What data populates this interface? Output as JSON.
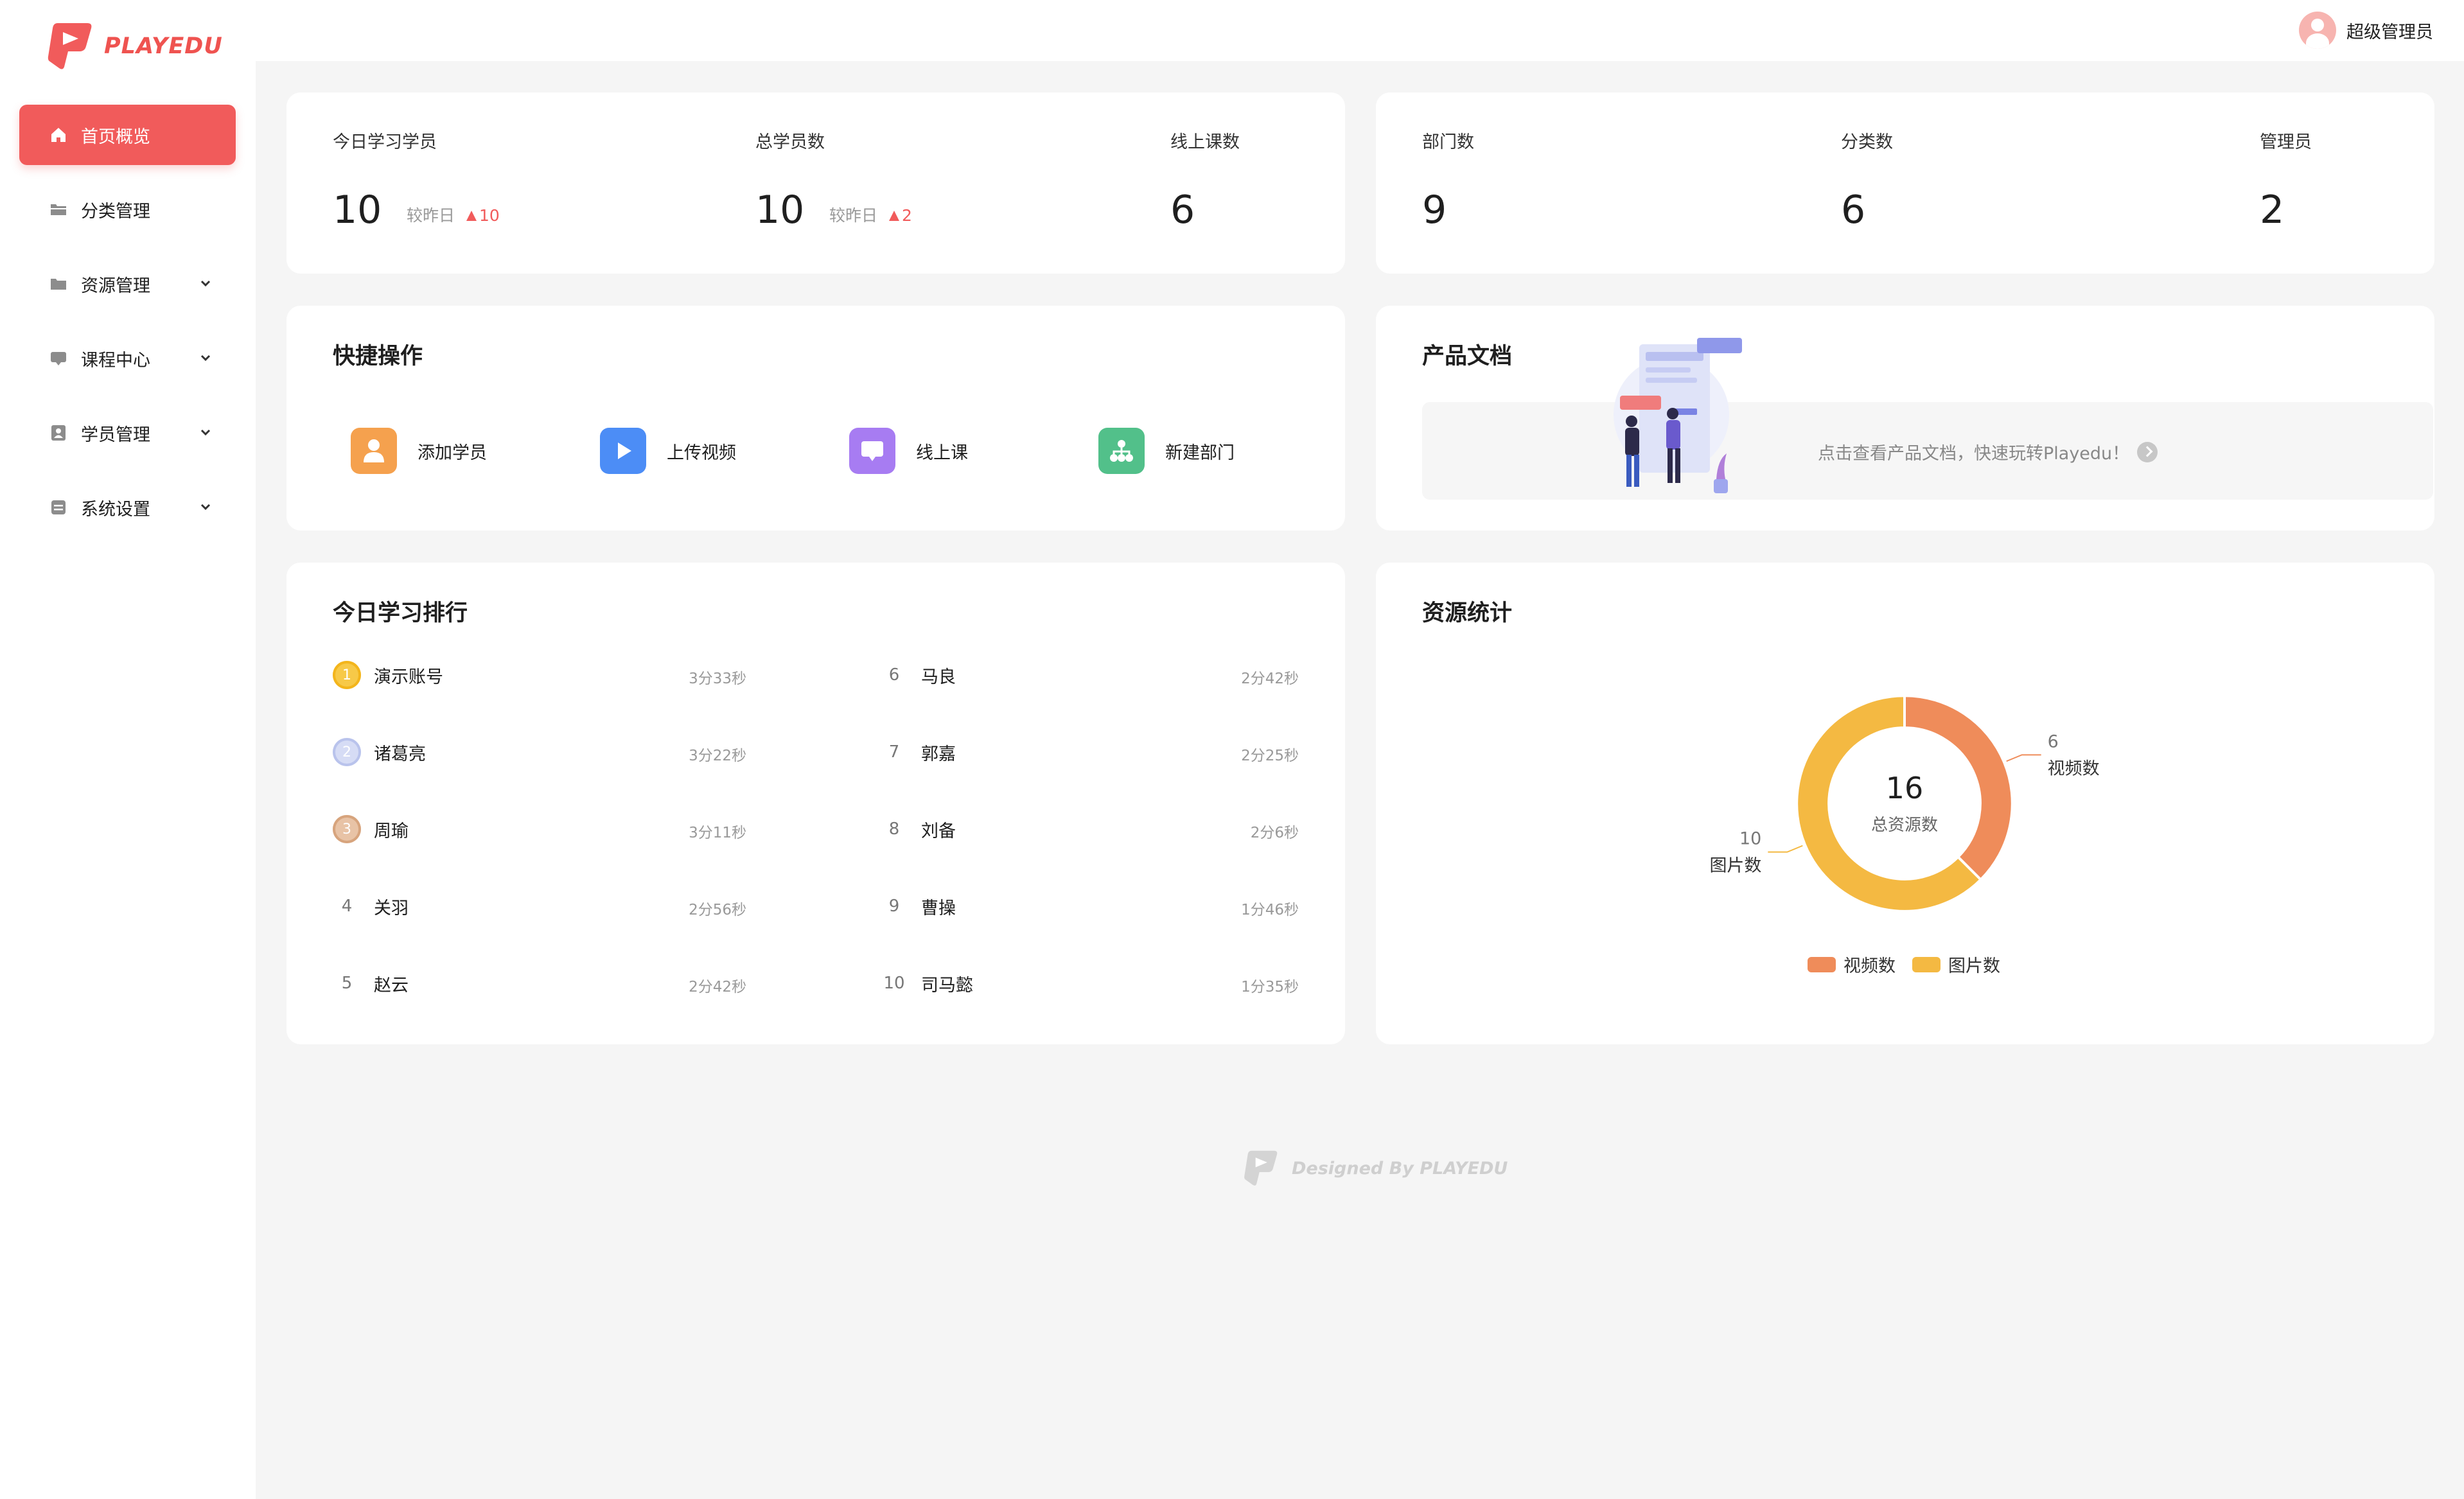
{
  "app": {
    "logo_text": "PLAYEDU",
    "brand_color": "#f15b5b"
  },
  "sidebar": {
    "items": [
      {
        "label": "首页概览",
        "icon": "home-icon",
        "active": true,
        "expandable": false
      },
      {
        "label": "分类管理",
        "icon": "folder-category-icon",
        "active": false,
        "expandable": false
      },
      {
        "label": "资源管理",
        "icon": "folder-icon",
        "active": false,
        "expandable": true
      },
      {
        "label": "课程中心",
        "icon": "monitor-icon",
        "active": false,
        "expandable": true
      },
      {
        "label": "学员管理",
        "icon": "user-card-icon",
        "active": false,
        "expandable": true
      },
      {
        "label": "系统设置",
        "icon": "settings-box-icon",
        "active": false,
        "expandable": true
      }
    ]
  },
  "header": {
    "user_name": "超级管理员"
  },
  "stats_left": [
    {
      "label": "今日学习学员",
      "value": "10",
      "compare_label": "较昨日",
      "compare_value": "10"
    },
    {
      "label": "总学员数",
      "value": "10",
      "compare_label": "较昨日",
      "compare_value": "2"
    },
    {
      "label": "线上课数",
      "value": "6"
    }
  ],
  "stats_right": [
    {
      "label": "部门数",
      "value": "9"
    },
    {
      "label": "分类数",
      "value": "6"
    },
    {
      "label": "管理员",
      "value": "2"
    }
  ],
  "quick_actions": {
    "title": "快捷操作",
    "items": [
      {
        "label": "添加学员",
        "icon": "add-user-icon",
        "color": "#f5a14e"
      },
      {
        "label": "上传视频",
        "icon": "play-icon",
        "color": "#4c8df6"
      },
      {
        "label": "线上课",
        "icon": "screen-icon",
        "color": "#a77cf2"
      },
      {
        "label": "新建部门",
        "icon": "org-chart-icon",
        "color": "#52c08a"
      }
    ]
  },
  "product_doc": {
    "title": "产品文档",
    "link_text": "点击查看产品文档，快速玩转Playedu！"
  },
  "ranking": {
    "title": "今日学习排行",
    "left": [
      {
        "rank": "1",
        "name": "演示账号",
        "time": "3分33秒"
      },
      {
        "rank": "2",
        "name": "诸葛亮",
        "time": "3分22秒"
      },
      {
        "rank": "3",
        "name": "周瑜",
        "time": "3分11秒"
      },
      {
        "rank": "4",
        "name": "关羽",
        "time": "2分56秒"
      },
      {
        "rank": "5",
        "name": "赵云",
        "time": "2分42秒"
      }
    ],
    "right": [
      {
        "rank": "6",
        "name": "马良",
        "time": "2分42秒"
      },
      {
        "rank": "7",
        "name": "郭嘉",
        "time": "2分25秒"
      },
      {
        "rank": "8",
        "name": "刘备",
        "time": "2分6秒"
      },
      {
        "rank": "9",
        "name": "曹操",
        "time": "1分46秒"
      },
      {
        "rank": "10",
        "name": "司马懿",
        "time": "1分35秒"
      }
    ]
  },
  "resources": {
    "title": "资源统计",
    "total": "16",
    "total_label": "总资源数"
  },
  "chart_data": {
    "type": "pie",
    "donut": true,
    "categories": [
      "视频数",
      "图片数"
    ],
    "values": [
      6,
      10
    ],
    "colors": [
      "#ef8c5a",
      "#f4b942"
    ],
    "legend": "bottom-center"
  },
  "footer": {
    "text": "Designed By PLAYEDU"
  }
}
